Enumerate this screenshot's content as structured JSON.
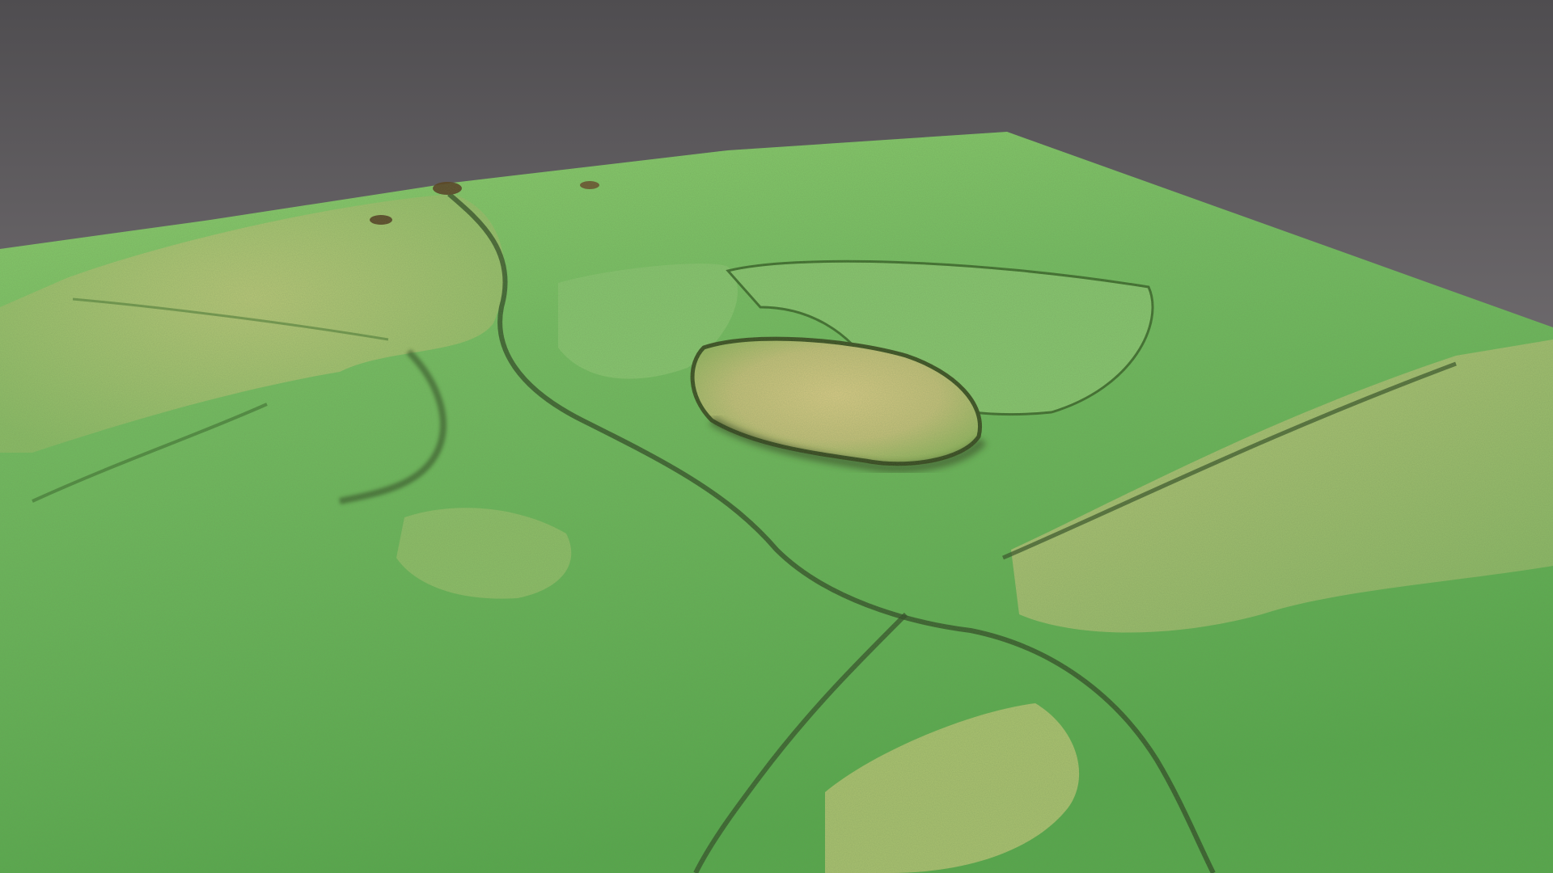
{
  "scene": {
    "background_top": "#555355",
    "background_bottom": "#767275",
    "terrain_low": "#4fa64a",
    "terrain_mid": "#79c266",
    "terrain_high": "#c7c67a",
    "terrain_peak": "#d8cf8a",
    "ridge_shadow": "#2f4a24",
    "vegetation_dark": "#5c4a2a"
  },
  "terrain_features": [
    {
      "name": "raised-plateau",
      "color": "#cfc27c"
    },
    {
      "name": "flat-basin",
      "color": "#86c56e"
    },
    {
      "name": "upland-field",
      "color": "#b7c87a"
    },
    {
      "name": "valley-floor",
      "color": "#64b458"
    }
  ]
}
